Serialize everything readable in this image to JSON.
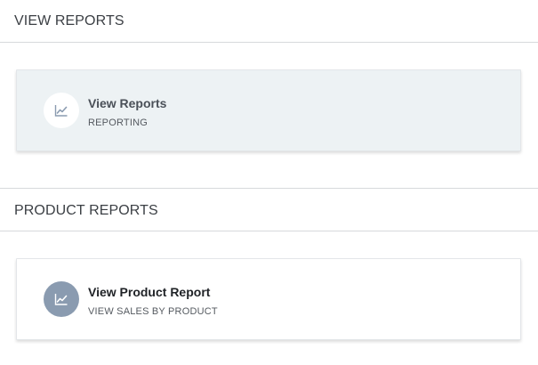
{
  "sections": {
    "view_reports": {
      "title": "VIEW REPORTS",
      "card": {
        "title": "View Reports",
        "subtitle": "REPORTING",
        "icon": "line-chart-icon"
      }
    },
    "product_reports": {
      "title": "PRODUCT REPORTS",
      "card": {
        "title": "View Product Report",
        "subtitle": "VIEW SALES BY PRODUCT",
        "icon": "line-chart-icon"
      }
    }
  },
  "colors": {
    "selected_card_bg": "#edf2f4",
    "icon_circle_muted": "#8a9bb0"
  }
}
